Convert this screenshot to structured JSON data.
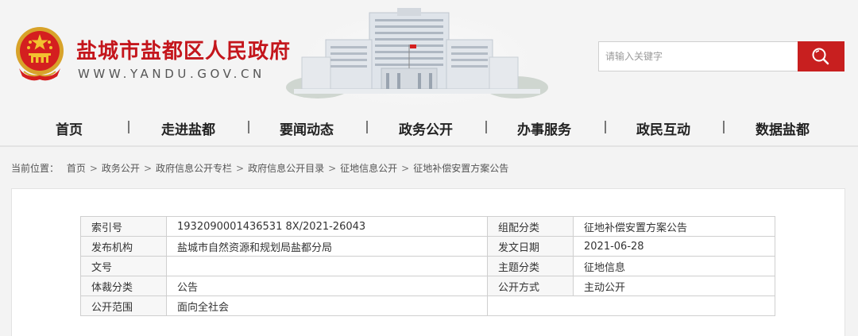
{
  "header": {
    "site_title": "盐城市盐都区人民政府",
    "site_url": "WWW.YANDU.GOV.CN",
    "brand_red": "#c4161c",
    "emblem_icon": "national-emblem-icon",
    "building_image": "government-building-image"
  },
  "search": {
    "placeholder": "请输入关键字",
    "button_icon": "search-icon",
    "button_color": "#c81f1f"
  },
  "nav": {
    "items": [
      "首页",
      "走进盐都",
      "要闻动态",
      "政务公开",
      "办事服务",
      "政民互动",
      "数据盐都"
    ]
  },
  "breadcrumb": {
    "prefix": "当前位置：",
    "items": [
      "首页",
      "政务公开",
      "政府信息公开专栏",
      "政府信息公开目录",
      "征地信息公开",
      "征地补偿安置方案公告"
    ],
    "separator": ">"
  },
  "meta_table": {
    "rows": [
      {
        "label1": "索引号",
        "value1": "1932090001436531 8X/2021-26043",
        "label2": "组配分类",
        "value2": "征地补偿安置方案公告"
      },
      {
        "label1": "发布机构",
        "value1": "盐城市自然资源和规划局盐都分局",
        "label2": "发文日期",
        "value2": "2021-06-28"
      },
      {
        "label1": "文号",
        "value1": "",
        "label2": "主题分类",
        "value2": "征地信息"
      },
      {
        "label1": "体裁分类",
        "value1": "公告",
        "label2": "公开方式",
        "value2": "主动公开"
      },
      {
        "label1": "公开范围",
        "value1": "面向全社会"
      }
    ]
  }
}
